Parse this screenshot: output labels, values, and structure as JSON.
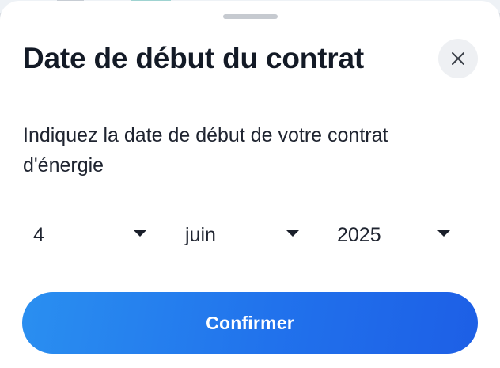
{
  "sheet": {
    "title": "Date de début du contrat",
    "description": "Indiquez la date de début de votre contrat d'énergie",
    "close_icon": "close-icon"
  },
  "date_picker": {
    "day": {
      "value": "4",
      "icon": "caret-down-icon"
    },
    "month": {
      "value": "juin",
      "icon": "caret-down-icon"
    },
    "year": {
      "value": "2025",
      "icon": "caret-down-icon"
    }
  },
  "actions": {
    "confirm_label": "Confirmer"
  },
  "colors": {
    "primary_gradient_start": "#2a8ff0",
    "primary_gradient_end": "#1d5fe6",
    "title_text": "#131a26",
    "close_bg": "#eef0f3",
    "handle": "#c6cad0"
  }
}
